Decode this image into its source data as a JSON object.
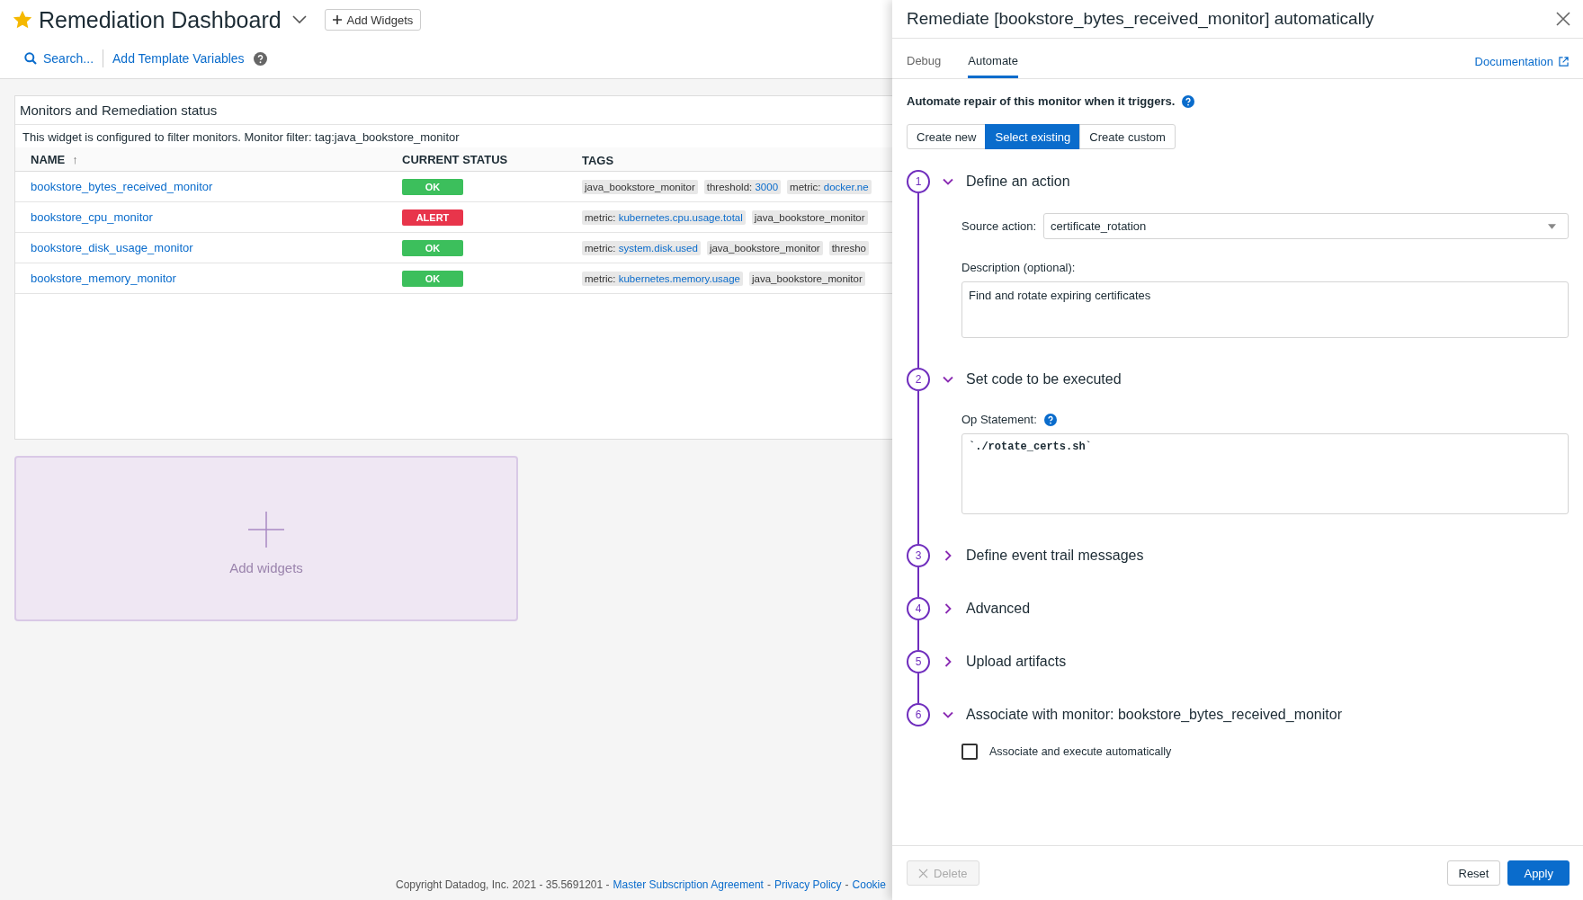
{
  "dashboard": {
    "title": "Remediation Dashboard",
    "starred": true,
    "add_button": "Add Widgets",
    "search_link": "Search...",
    "template_link": "Add Template Variables"
  },
  "widget": {
    "title": "Monitors and Remediation status",
    "filter_note": "This widget is configured to filter monitors. Monitor filter: tag:java_bookstore_monitor",
    "columns": [
      {
        "label": "NAME",
        "sort": "↑"
      },
      {
        "label": "CURRENT STATUS"
      },
      {
        "label": "TAGS"
      }
    ],
    "rows": [
      {
        "name": "bookstore_bytes_received_monitor",
        "status": {
          "label": "OK",
          "color": "#3cbf5c"
        },
        "tags": [
          {
            "text": "java_bookstore_monitor"
          },
          {
            "key": "threshold:",
            "value": "3000"
          },
          {
            "key": "metric:",
            "value": "docker.ne"
          }
        ]
      },
      {
        "name": "bookstore_cpu_monitor",
        "status": {
          "label": "ALERT",
          "color": "#e8354b"
        },
        "tags": [
          {
            "key": "metric:",
            "value": "kubernetes.cpu.usage.total"
          },
          {
            "text": "java_bookstore_monitor"
          }
        ]
      },
      {
        "name": "bookstore_disk_usage_monitor",
        "status": {
          "label": "OK",
          "color": "#3cbf5c"
        },
        "tags": [
          {
            "key": "metric:",
            "value": "system.disk.used"
          },
          {
            "text": "java_bookstore_monitor"
          },
          {
            "text": "thresho"
          }
        ]
      },
      {
        "name": "bookstore_memory_monitor",
        "status": {
          "label": "OK",
          "color": "#3cbf5c"
        },
        "tags": [
          {
            "key": "metric:",
            "value": "kubernetes.memory.usage"
          },
          {
            "text": "java_bookstore_monitor"
          }
        ]
      }
    ]
  },
  "add_widgets_placeholder": {
    "label": "Add widgets"
  },
  "footer": {
    "copyright": "Copyright Datadog, Inc. 2021 - 35.5691201 -",
    "separator": "-",
    "links": [
      "Master Subscription Agreement",
      "Privacy Policy",
      "Cookie"
    ]
  },
  "panel": {
    "title": "Remediate [bookstore_bytes_received_monitor] automatically",
    "tabs": [
      {
        "label": "Debug",
        "selected": false
      },
      {
        "label": "Automate",
        "selected": true
      }
    ],
    "documentation_link": "Documentation",
    "intro": "Automate repair of this monitor when it triggers.",
    "modes": [
      {
        "label": "Create new",
        "selected": false
      },
      {
        "label": "Select existing",
        "selected": true
      },
      {
        "label": "Create custom",
        "selected": false
      }
    ],
    "steps": [
      {
        "number": "1",
        "title": "Define an action",
        "expanded": true,
        "fields": [
          {
            "kind": "select",
            "label": "Source action:",
            "value": "certificate_rotation"
          },
          {
            "kind": "textarea",
            "label": "Description (optional):",
            "value": "Find and rotate expiring certificates"
          }
        ]
      },
      {
        "number": "2",
        "title": "Set code to be executed",
        "expanded": true,
        "fields": [
          {
            "kind": "code",
            "label": "Op Statement:",
            "value": "`./rotate_certs.sh`"
          }
        ]
      },
      {
        "number": "3",
        "title": "Define event trail messages",
        "expanded": false
      },
      {
        "number": "4",
        "title": "Advanced",
        "expanded": false
      },
      {
        "number": "5",
        "title": "Upload artifacts",
        "expanded": false
      },
      {
        "number": "6",
        "title": "Associate with monitor: bookstore_bytes_received_monitor",
        "expanded": true,
        "fields": [
          {
            "kind": "checkbox",
            "label": "Associate and execute automatically",
            "checked": false
          }
        ]
      }
    ],
    "delete_button": {
      "label": "Delete",
      "disabled": true
    },
    "reset_button": "Reset",
    "apply_button": "Apply"
  }
}
